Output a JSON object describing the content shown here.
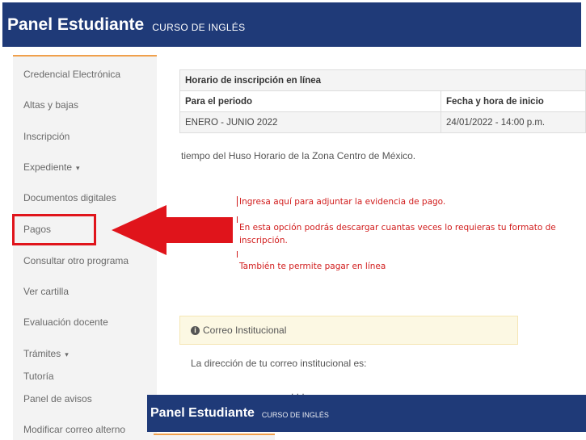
{
  "header": {
    "title": "Panel Estudiante",
    "subtitle": "CURSO DE INGLÉS"
  },
  "sidebar": {
    "items": [
      {
        "label": "Credencial Electrónica"
      },
      {
        "label": "Altas y bajas"
      },
      {
        "label": "Inscripción"
      },
      {
        "label": "Expediente",
        "dropdown": true
      },
      {
        "label": "Documentos digitales"
      },
      {
        "label": "Pagos",
        "highlighted": true
      },
      {
        "label": "Consultar otro programa"
      },
      {
        "label": "Ver cartilla"
      },
      {
        "label": "Evaluación docente"
      },
      {
        "label": "Trámites",
        "dropdown": true
      },
      {
        "label": "Tutoría"
      },
      {
        "label": "Panel de avisos"
      },
      {
        "label": "Modificar correo alterno"
      }
    ],
    "caret": "▾"
  },
  "schedule_table": {
    "caption": "Horario de inscripción en línea",
    "headers": [
      "Para el periodo",
      "Fecha y hora de inicio"
    ],
    "rows": [
      [
        "ENERO - JUNIO 2022",
        "24/01/2022 - 14:00 p.m."
      ]
    ]
  },
  "timezone_note": "tiempo del Huso Horario de la Zona Centro de México.",
  "annotations": {
    "line1": "Ingresa aquí para adjuntar la evidencia de pago.",
    "line2": "En esta opción podrás descargar cuantas veces lo requieras tu formato de",
    "line2b": "inscripción.",
    "line3": "También te permite pagar en línea",
    "color": "#d11c1c"
  },
  "email_panel": {
    "heading": "Correo Institucional",
    "icon": "info-icon",
    "body": "La dirección de tu correo institucional es:",
    "partial": ". . ."
  },
  "footer_header": {
    "title": "Panel Estudiante",
    "subtitle": "CURSO DE INGLÉS"
  },
  "colors": {
    "brand": "#1f3a78",
    "accent": "#f0a04b",
    "highlight": "#e0141b"
  }
}
